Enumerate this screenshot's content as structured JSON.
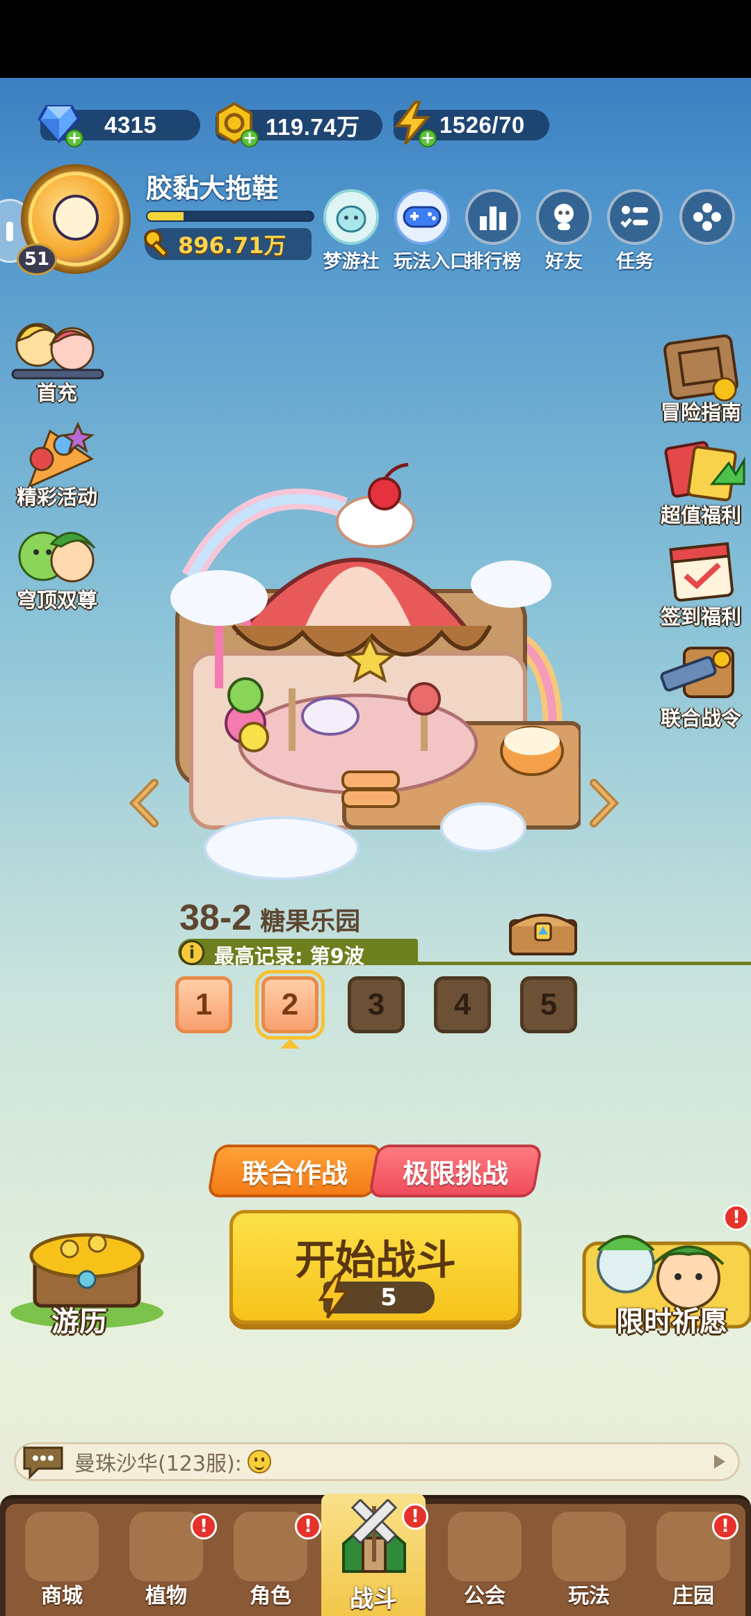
{
  "resources": {
    "diamonds": "4315",
    "gold": "119.74万",
    "energy": "1526/70"
  },
  "profile": {
    "name": "胶黏大拖鞋",
    "level": "51",
    "power": "896.71万",
    "exp_fraction": 0.22
  },
  "top_menu": [
    {
      "label": "梦游社",
      "icon": "mascot-icon"
    },
    {
      "label": "玩法入口",
      "icon": "gamepad-icon"
    },
    {
      "label": "排行榜",
      "icon": "leaderboard-icon"
    },
    {
      "label": "好友",
      "icon": "friends-icon"
    },
    {
      "label": "任务",
      "icon": "tasks-icon"
    },
    {
      "label": "",
      "icon": "more-icon"
    }
  ],
  "left_side": [
    {
      "label": "首充",
      "icon": "first-recharge-icon"
    },
    {
      "label": "精彩活动",
      "icon": "events-icon"
    },
    {
      "label": "穹顶双尊",
      "icon": "dome-duo-icon"
    }
  ],
  "right_side": [
    {
      "label": "冒险指南",
      "icon": "adventure-guide-icon"
    },
    {
      "label": "超值福利",
      "icon": "value-benefits-icon"
    },
    {
      "label": "签到福利",
      "icon": "checkin-icon"
    },
    {
      "label": "联合战令",
      "icon": "battle-pass-icon"
    }
  ],
  "stage": {
    "number": "38-2",
    "name": "糖果乐园",
    "record": "最高记录: 第9波",
    "waves": [
      "1",
      "2",
      "3",
      "4",
      "5"
    ],
    "selected_wave": 2
  },
  "modes": {
    "coop": "联合作战",
    "limit": "极限挑战"
  },
  "start": {
    "label": "开始战斗",
    "cost": "5"
  },
  "features": {
    "travel": "游历",
    "wish": "限时祈愿",
    "alert": "!"
  },
  "chat": {
    "text": "曼珠沙华(123服):"
  },
  "nav": [
    {
      "label": "商城",
      "icon": "shop-icon",
      "alert": false
    },
    {
      "label": "植物",
      "icon": "plants-icon",
      "alert": true
    },
    {
      "label": "角色",
      "icon": "characters-icon",
      "alert": true
    },
    {
      "label": "战斗",
      "icon": "battle-icon",
      "alert": true
    },
    {
      "label": "公会",
      "icon": "guild-icon",
      "alert": false
    },
    {
      "label": "玩法",
      "icon": "gameplay-icon",
      "alert": false
    },
    {
      "label": "庄园",
      "icon": "manor-icon",
      "alert": true
    }
  ],
  "colors": {
    "accent_yellow": "#f6c21a",
    "coop_orange": "#f37b16",
    "limit_red": "#ef4d5a",
    "nav_brown": "#8a5a36"
  }
}
